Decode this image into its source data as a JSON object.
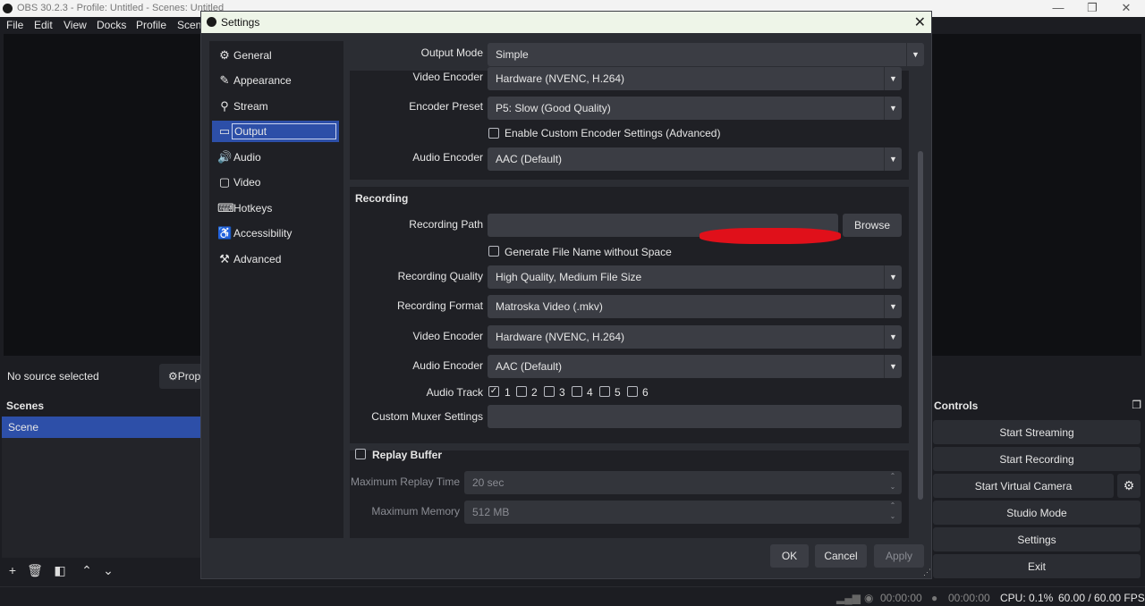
{
  "app": {
    "title": "OBS 30.2.3 - Profile: Untitled - Scenes: Untitled",
    "menu": [
      "File",
      "Edit",
      "View",
      "Docks",
      "Profile",
      "Scen"
    ]
  },
  "sources": {
    "no_source": "No source selected",
    "properties": "Prop"
  },
  "scenes": {
    "header": "Scenes",
    "items": [
      "Scene"
    ]
  },
  "controls": {
    "header": "Controls",
    "buttons": [
      "Start Streaming",
      "Start Recording",
      "Start Virtual Camera",
      "Studio Mode",
      "Settings",
      "Exit"
    ]
  },
  "status": {
    "stream_time": "00:00:00",
    "rec_time": "00:00:00",
    "cpu": "CPU: 0.1%",
    "fps": "60.00 / 60.00 FPS"
  },
  "dialog": {
    "title": "Settings",
    "nav": [
      {
        "label": "General",
        "icon": "gear-icon"
      },
      {
        "label": "Appearance",
        "icon": "appearance-icon"
      },
      {
        "label": "Stream",
        "icon": "antenna-icon"
      },
      {
        "label": "Output",
        "icon": "output-icon"
      },
      {
        "label": "Audio",
        "icon": "speaker-icon"
      },
      {
        "label": "Video",
        "icon": "monitor-icon"
      },
      {
        "label": "Hotkeys",
        "icon": "keyboard-icon"
      },
      {
        "label": "Accessibility",
        "icon": "accessibility-icon"
      },
      {
        "label": "Advanced",
        "icon": "tools-icon"
      }
    ],
    "selected_nav": "Output",
    "output_mode_label": "Output Mode",
    "output_mode_value": "Simple",
    "streaming": {
      "video_encoder_label": "Video Encoder",
      "video_encoder_value": "Hardware (NVENC, H.264)",
      "encoder_preset_label": "Encoder Preset",
      "encoder_preset_value": "P5: Slow (Good Quality)",
      "custom_encoder_label": "Enable Custom Encoder Settings (Advanced)",
      "audio_encoder_label": "Audio Encoder",
      "audio_encoder_value": "AAC (Default)"
    },
    "recording": {
      "header": "Recording",
      "path_label": "Recording Path",
      "browse": "Browse",
      "filename_nospace_label": "Generate File Name without Space",
      "quality_label": "Recording Quality",
      "quality_value": "High Quality, Medium File Size",
      "format_label": "Recording Format",
      "format_value": "Matroska Video (.mkv)",
      "video_encoder_label": "Video Encoder",
      "video_encoder_value": "Hardware (NVENC, H.264)",
      "audio_encoder_label": "Audio Encoder",
      "audio_encoder_value": "AAC (Default)",
      "audio_track_label": "Audio Track",
      "tracks": [
        "1",
        "2",
        "3",
        "4",
        "5",
        "6"
      ],
      "custom_muxer_label": "Custom Muxer Settings"
    },
    "replay": {
      "header": "Replay Buffer",
      "max_time_label": "Maximum Replay Time",
      "max_time_value": "20 sec",
      "max_memory_label": "Maximum Memory",
      "max_memory_value": "512 MB"
    },
    "buttons": {
      "ok": "OK",
      "cancel": "Cancel",
      "apply": "Apply"
    }
  }
}
